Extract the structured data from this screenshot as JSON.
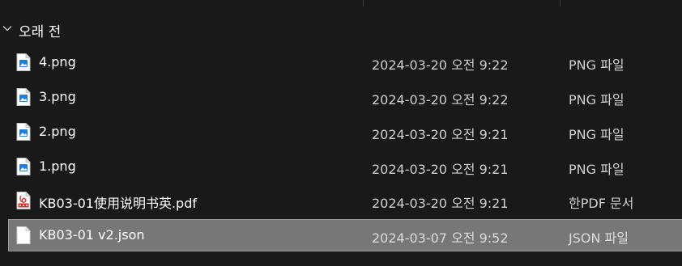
{
  "group": {
    "title": "오래 전",
    "expanded": true,
    "icon": "chevron-down-icon"
  },
  "files": [
    {
      "name": "4.png",
      "date": "2024-03-20 오전 9:22",
      "type": "PNG 파일",
      "icon": "image-file-icon"
    },
    {
      "name": "3.png",
      "date": "2024-03-20 오전 9:22",
      "type": "PNG 파일",
      "icon": "image-file-icon"
    },
    {
      "name": "2.png",
      "date": "2024-03-20 오전 9:21",
      "type": "PNG 파일",
      "icon": "image-file-icon"
    },
    {
      "name": "1.png",
      "date": "2024-03-20 오전 9:21",
      "type": "PNG 파일",
      "icon": "image-file-icon"
    },
    {
      "name": "KB03-01使用说明书英.pdf",
      "date": "2024-03-20 오전 9:21",
      "type": "한PDF 문서",
      "icon": "pdf-file-icon"
    },
    {
      "name": "KB03-01 v2.json",
      "date": "2024-03-07 오전 9:52",
      "type": "JSON 파일",
      "icon": "document-file-icon",
      "selected": true
    }
  ],
  "colors": {
    "background": "#191919",
    "selected_row": "#777777",
    "image_icon_blue": "#1f7fd6",
    "pdf_icon_red": "#d9322b"
  }
}
